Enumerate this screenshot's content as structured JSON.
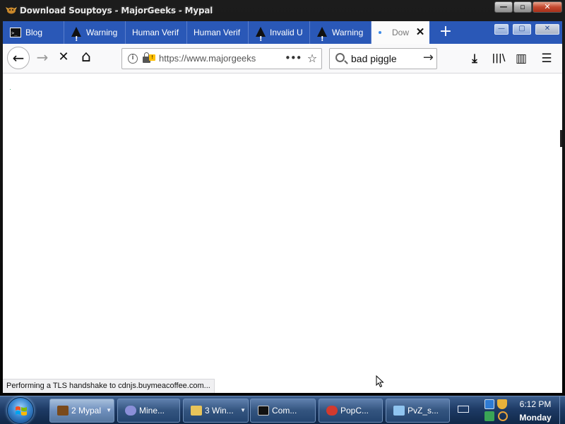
{
  "window": {
    "title": "Download Souptoys - MajorGeeks - Mypal",
    "controls": {
      "minimize": "—",
      "restore": "▫",
      "close": "✕"
    }
  },
  "tabs": [
    {
      "label": "Blog",
      "icon": "terminal-icon",
      "active": false
    },
    {
      "label": "Warning",
      "icon": "warning-icon",
      "active": false
    },
    {
      "label": "Human Verif",
      "icon": "none",
      "active": false
    },
    {
      "label": "Human Verif",
      "icon": "none",
      "active": false
    },
    {
      "label": "Invalid U",
      "icon": "warning-icon",
      "active": false
    },
    {
      "label": "Warning",
      "icon": "warning-icon",
      "active": false
    },
    {
      "label": "Dow",
      "icon": "loading-dot-icon",
      "active": true
    }
  ],
  "tab_controls": {
    "new_tab": "+",
    "minimize": "—",
    "restore": "▢",
    "close": "✕"
  },
  "navbar": {
    "back": "←",
    "forward": "→",
    "stop": "✕",
    "home": "⌂",
    "url": "https://www.majorgeeks",
    "url_more": "•••",
    "bookmark_star": "☆",
    "search_query": "bad piggle",
    "search_go": "→",
    "downloads": "⤓",
    "library": "|||\\",
    "sidebar": "▥",
    "menu": "☰"
  },
  "status_text": "Performing a TLS handshake to cdnjs.buymeacoffee.com...",
  "taskbar": {
    "items": [
      {
        "label": "2 Mypal",
        "count": "2",
        "name": "Mypal",
        "active": true,
        "has_arrow": true,
        "icon_color": "#7a4a1c"
      },
      {
        "label": "Mine...",
        "active": false,
        "has_arrow": false,
        "icon_color": "#8a8fd8"
      },
      {
        "label": "3 Win...",
        "count": "3",
        "name": "Win...",
        "active": false,
        "has_arrow": true,
        "icon_color": "#e8c45a"
      },
      {
        "label": "Com...",
        "active": false,
        "has_arrow": false,
        "icon_color": "#111111"
      },
      {
        "label": "PopC...",
        "active": false,
        "has_arrow": false,
        "icon_color": "#d23a2e"
      },
      {
        "label": "PvZ_s...",
        "active": false,
        "has_arrow": false,
        "icon_color": "#8fc4f0"
      }
    ],
    "clock_time": "6:12 PM",
    "clock_day": "Monday"
  },
  "colors": {
    "tabstrip": "#2a58b7",
    "taskbar": "#1e3b66",
    "warning_badge": "#ffbf00"
  }
}
